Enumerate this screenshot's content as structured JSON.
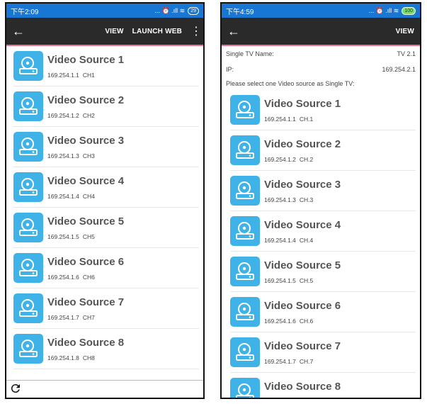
{
  "left": {
    "status": {
      "time": "下午2:09",
      "icons": "... ⏰ .ıll ≋",
      "battery": "29"
    },
    "appbar": {
      "back": "←",
      "view": "VIEW",
      "launch_web": "LAUNCH WEB",
      "menu": "⋮"
    },
    "sources": [
      {
        "name": "Video Source 1",
        "ip": "169.254.1.1",
        "ch": "CH1"
      },
      {
        "name": "Video Source 2",
        "ip": "169.254.1.2",
        "ch": "CH2"
      },
      {
        "name": "Video Source 3",
        "ip": "169.254.1.3",
        "ch": "CH3"
      },
      {
        "name": "Video Source 4",
        "ip": "169.254.1.4",
        "ch": "CH4"
      },
      {
        "name": "Video Source 5",
        "ip": "169.254.1.5",
        "ch": "CH5"
      },
      {
        "name": "Video Source 6",
        "ip": "169.254.1.6",
        "ch": "CH6"
      },
      {
        "name": "Video Source 7",
        "ip": "169.254.1.7",
        "ch": "CH7"
      },
      {
        "name": "Video Source 8",
        "ip": "169.254.1.8",
        "ch": "CH8"
      }
    ],
    "refresh_icon": "C"
  },
  "right": {
    "status": {
      "time": "下午4:59",
      "icons": "... ⏰ .ıll ≋",
      "battery": "100"
    },
    "appbar": {
      "back": "←",
      "view": "VIEW"
    },
    "tv_name_label": "Single TV Name:",
    "tv_name_value": "TV 2.1",
    "ip_label": "IP:",
    "ip_value": "169.254.2.1",
    "prompt": "Please select one Video source as Single TV:",
    "sources": [
      {
        "name": "Video Source 1",
        "ip": "169.254.1.1",
        "ch": "CH.1"
      },
      {
        "name": "Video Source 2",
        "ip": "169.254.1.2",
        "ch": "CH.2"
      },
      {
        "name": "Video Source 3",
        "ip": "169.254.1.3",
        "ch": "CH.3"
      },
      {
        "name": "Video Source 4",
        "ip": "169.254.1.4",
        "ch": "CH.4"
      },
      {
        "name": "Video Source 5",
        "ip": "169.254.1.5",
        "ch": "CH.5"
      },
      {
        "name": "Video Source 6",
        "ip": "169.254.1.6",
        "ch": "CH.6"
      },
      {
        "name": "Video Source 7",
        "ip": "169.254.1.7",
        "ch": "CH.7"
      },
      {
        "name": "Video Source 8",
        "ip": "",
        "ch": ""
      }
    ]
  },
  "colors": {
    "statusbar": "#1976d2",
    "appbar": "#2a2a2a",
    "accent_line": "#e57390",
    "icon_bg": "#3fb3e8"
  }
}
